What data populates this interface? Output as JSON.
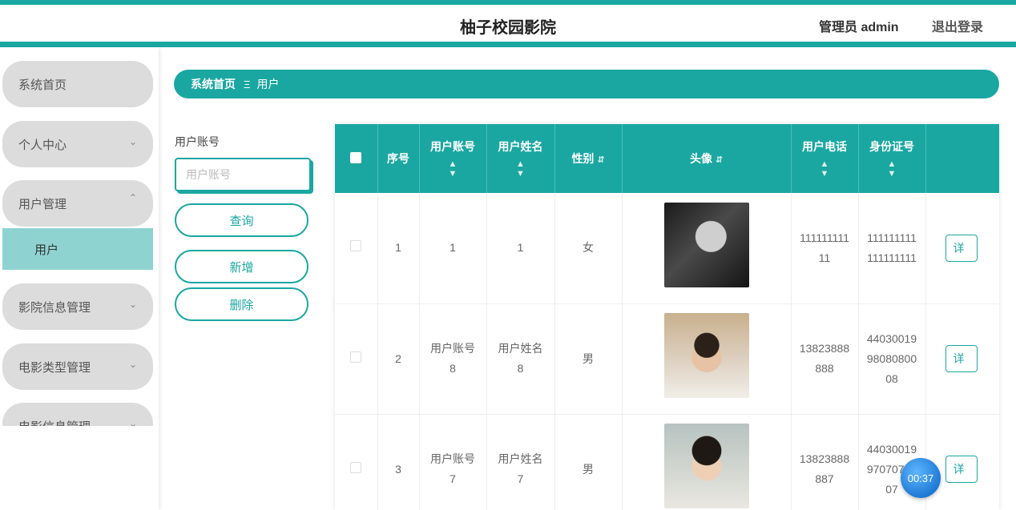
{
  "header": {
    "title": "柚子校园影院",
    "admin_label": "管理员 admin",
    "logout_label": "退出登录"
  },
  "sidebar": {
    "items": [
      {
        "label": "系统首页"
      },
      {
        "label": "个人中心",
        "icon": "chevron-down-icon"
      },
      {
        "label": "用户管理",
        "icon": "chevron-up-icon"
      },
      {
        "label": "影院信息管理",
        "icon": "chevron-down-icon"
      },
      {
        "label": "电影类型管理",
        "icon": "chevron-down-icon"
      },
      {
        "label": "电影信息管理",
        "icon": "chevron-down-icon"
      }
    ],
    "active_sub": "用户"
  },
  "breadcrumb": {
    "home": "系统首页",
    "separator_icon": "menu-icon",
    "current": "用户"
  },
  "search": {
    "label": "用户账号",
    "placeholder": "用户账号",
    "query_label": "查询",
    "add_label": "新增",
    "delete_label": "删除"
  },
  "table": {
    "headers": {
      "index": "序号",
      "account": "用户账号",
      "name": "用户姓名",
      "gender": "性别",
      "avatar": "头像",
      "phone": "用户电话",
      "idcard": "身份证号"
    },
    "rows": [
      {
        "index": "1",
        "account": "1",
        "name": "1",
        "gender": "女",
        "phone": "11111111111",
        "idcard": "111111111111111111",
        "detail": "详",
        "avatar": "avatar-dark"
      },
      {
        "index": "2",
        "account": "用户账号8",
        "name": "用户姓名8",
        "gender": "男",
        "phone": "13823888888",
        "idcard": "440300199808080008",
        "detail": "详",
        "avatar": "avatar-boy"
      },
      {
        "index": "3",
        "account": "用户账号7",
        "name": "用户姓名7",
        "gender": "男",
        "phone": "13823888887",
        "idcard": "440300199707070007",
        "detail": "详",
        "avatar": "avatar-boy-2"
      }
    ]
  },
  "timer": "00:37",
  "colors": {
    "accent": "#1aa7a1",
    "active_sub": "#8fd3d1",
    "nav_bg": "#dcdcdc"
  }
}
